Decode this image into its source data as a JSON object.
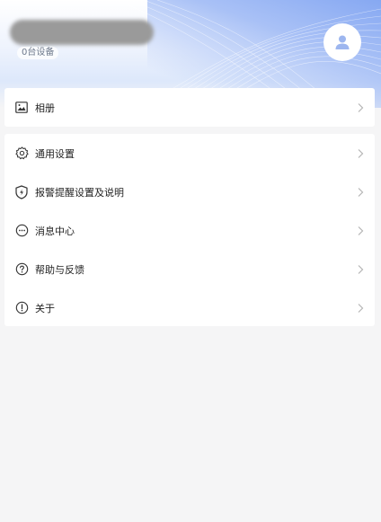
{
  "profile": {
    "device_count": "0台设备"
  },
  "menu_primary": [
    {
      "label": "相册",
      "icon": "image-icon"
    }
  ],
  "menu_secondary": [
    {
      "label": "通用设置",
      "icon": "gear-icon"
    },
    {
      "label": "报警提醒设置及说明",
      "icon": "shield-alert-icon"
    },
    {
      "label": "消息中心",
      "icon": "message-icon"
    },
    {
      "label": "帮助与反馈",
      "icon": "help-icon"
    },
    {
      "label": "关于",
      "icon": "info-icon"
    }
  ],
  "colors": {
    "accent": "#86a8f2",
    "background": "#f5f5f6",
    "card": "#ffffff",
    "text": "#222222",
    "icon": "#333333",
    "chevron": "#b5b5b5"
  }
}
